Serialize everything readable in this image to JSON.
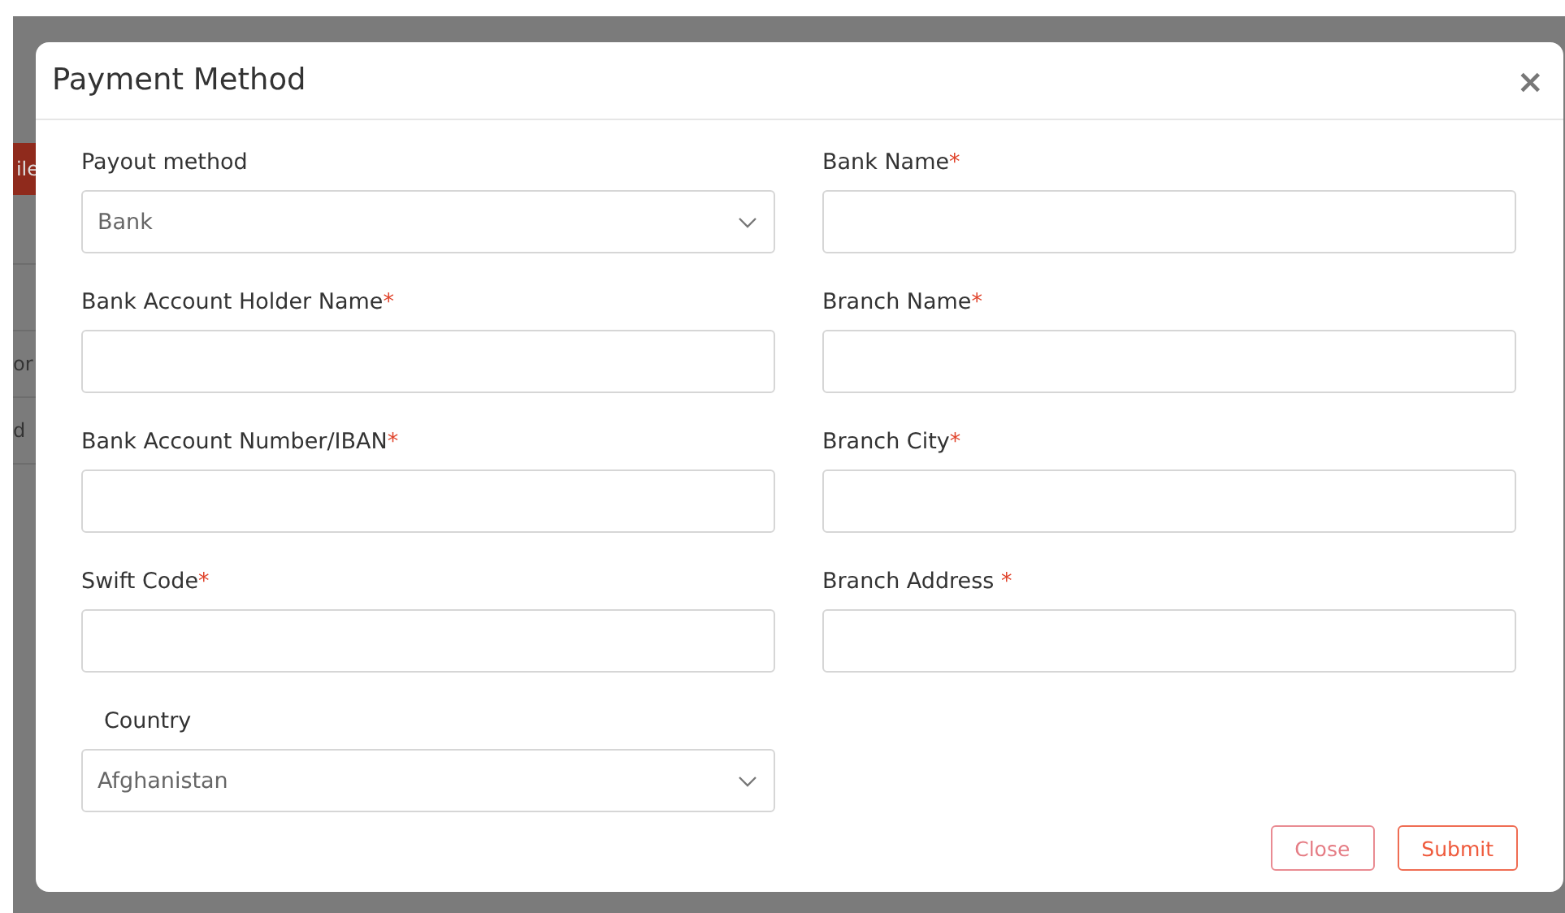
{
  "background": {
    "button_fragment": "ile",
    "row_fragments": [
      "or",
      "d"
    ]
  },
  "dialog": {
    "title": "Payment Method",
    "close_icon": "×",
    "left_column": [
      {
        "kind": "select",
        "label": "Payout method",
        "value": "Bank"
      },
      {
        "kind": "text",
        "label": "Bank Account Holder Name",
        "required_mark": "*"
      },
      {
        "kind": "text",
        "label": "Bank Account Number/IBAN",
        "required_mark": "*"
      },
      {
        "kind": "text",
        "label": "Swift Code",
        "required_mark": "*"
      },
      {
        "kind": "select",
        "label": "Country",
        "value": "Afghanistan",
        "indented_label": true
      }
    ],
    "right_column": [
      {
        "kind": "text",
        "label": "Bank Name",
        "required_mark": "*"
      },
      {
        "kind": "text",
        "label": "Branch Name",
        "required_mark": "*"
      },
      {
        "kind": "text",
        "label": "Branch City",
        "required_mark": "*"
      },
      {
        "kind": "text",
        "label": "Branch Address",
        "required_mark": " *"
      }
    ],
    "buttons": [
      {
        "kind": "secondary",
        "label": "Close"
      },
      {
        "kind": "primary",
        "label": "Submit"
      }
    ]
  }
}
